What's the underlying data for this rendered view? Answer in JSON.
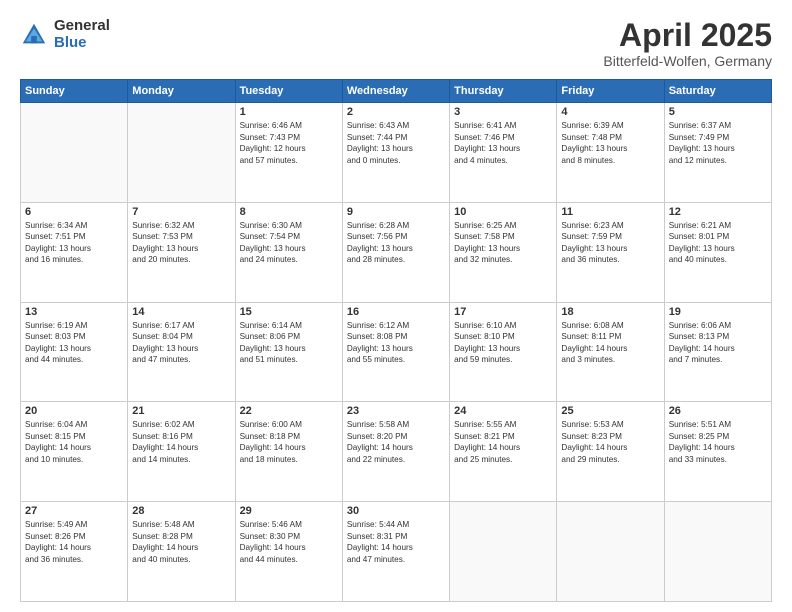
{
  "header": {
    "logo_general": "General",
    "logo_blue": "Blue",
    "month_title": "April 2025",
    "location": "Bitterfeld-Wolfen, Germany"
  },
  "weekdays": [
    "Sunday",
    "Monday",
    "Tuesday",
    "Wednesday",
    "Thursday",
    "Friday",
    "Saturday"
  ],
  "weeks": [
    [
      {
        "day": "",
        "info": ""
      },
      {
        "day": "",
        "info": ""
      },
      {
        "day": "1",
        "info": "Sunrise: 6:46 AM\nSunset: 7:43 PM\nDaylight: 12 hours and 57 minutes."
      },
      {
        "day": "2",
        "info": "Sunrise: 6:43 AM\nSunset: 7:44 PM\nDaylight: 13 hours and 0 minutes."
      },
      {
        "day": "3",
        "info": "Sunrise: 6:41 AM\nSunset: 7:46 PM\nDaylight: 13 hours and 4 minutes."
      },
      {
        "day": "4",
        "info": "Sunrise: 6:39 AM\nSunset: 7:48 PM\nDaylight: 13 hours and 8 minutes."
      },
      {
        "day": "5",
        "info": "Sunrise: 6:37 AM\nSunset: 7:49 PM\nDaylight: 13 hours and 12 minutes."
      }
    ],
    [
      {
        "day": "6",
        "info": "Sunrise: 6:34 AM\nSunset: 7:51 PM\nDaylight: 13 hours and 16 minutes."
      },
      {
        "day": "7",
        "info": "Sunrise: 6:32 AM\nSunset: 7:53 PM\nDaylight: 13 hours and 20 minutes."
      },
      {
        "day": "8",
        "info": "Sunrise: 6:30 AM\nSunset: 7:54 PM\nDaylight: 13 hours and 24 minutes."
      },
      {
        "day": "9",
        "info": "Sunrise: 6:28 AM\nSunset: 7:56 PM\nDaylight: 13 hours and 28 minutes."
      },
      {
        "day": "10",
        "info": "Sunrise: 6:25 AM\nSunset: 7:58 PM\nDaylight: 13 hours and 32 minutes."
      },
      {
        "day": "11",
        "info": "Sunrise: 6:23 AM\nSunset: 7:59 PM\nDaylight: 13 hours and 36 minutes."
      },
      {
        "day": "12",
        "info": "Sunrise: 6:21 AM\nSunset: 8:01 PM\nDaylight: 13 hours and 40 minutes."
      }
    ],
    [
      {
        "day": "13",
        "info": "Sunrise: 6:19 AM\nSunset: 8:03 PM\nDaylight: 13 hours and 44 minutes."
      },
      {
        "day": "14",
        "info": "Sunrise: 6:17 AM\nSunset: 8:04 PM\nDaylight: 13 hours and 47 minutes."
      },
      {
        "day": "15",
        "info": "Sunrise: 6:14 AM\nSunset: 8:06 PM\nDaylight: 13 hours and 51 minutes."
      },
      {
        "day": "16",
        "info": "Sunrise: 6:12 AM\nSunset: 8:08 PM\nDaylight: 13 hours and 55 minutes."
      },
      {
        "day": "17",
        "info": "Sunrise: 6:10 AM\nSunset: 8:10 PM\nDaylight: 13 hours and 59 minutes."
      },
      {
        "day": "18",
        "info": "Sunrise: 6:08 AM\nSunset: 8:11 PM\nDaylight: 14 hours and 3 minutes."
      },
      {
        "day": "19",
        "info": "Sunrise: 6:06 AM\nSunset: 8:13 PM\nDaylight: 14 hours and 7 minutes."
      }
    ],
    [
      {
        "day": "20",
        "info": "Sunrise: 6:04 AM\nSunset: 8:15 PM\nDaylight: 14 hours and 10 minutes."
      },
      {
        "day": "21",
        "info": "Sunrise: 6:02 AM\nSunset: 8:16 PM\nDaylight: 14 hours and 14 minutes."
      },
      {
        "day": "22",
        "info": "Sunrise: 6:00 AM\nSunset: 8:18 PM\nDaylight: 14 hours and 18 minutes."
      },
      {
        "day": "23",
        "info": "Sunrise: 5:58 AM\nSunset: 8:20 PM\nDaylight: 14 hours and 22 minutes."
      },
      {
        "day": "24",
        "info": "Sunrise: 5:55 AM\nSunset: 8:21 PM\nDaylight: 14 hours and 25 minutes."
      },
      {
        "day": "25",
        "info": "Sunrise: 5:53 AM\nSunset: 8:23 PM\nDaylight: 14 hours and 29 minutes."
      },
      {
        "day": "26",
        "info": "Sunrise: 5:51 AM\nSunset: 8:25 PM\nDaylight: 14 hours and 33 minutes."
      }
    ],
    [
      {
        "day": "27",
        "info": "Sunrise: 5:49 AM\nSunset: 8:26 PM\nDaylight: 14 hours and 36 minutes."
      },
      {
        "day": "28",
        "info": "Sunrise: 5:48 AM\nSunset: 8:28 PM\nDaylight: 14 hours and 40 minutes."
      },
      {
        "day": "29",
        "info": "Sunrise: 5:46 AM\nSunset: 8:30 PM\nDaylight: 14 hours and 44 minutes."
      },
      {
        "day": "30",
        "info": "Sunrise: 5:44 AM\nSunset: 8:31 PM\nDaylight: 14 hours and 47 minutes."
      },
      {
        "day": "",
        "info": ""
      },
      {
        "day": "",
        "info": ""
      },
      {
        "day": "",
        "info": ""
      }
    ]
  ]
}
